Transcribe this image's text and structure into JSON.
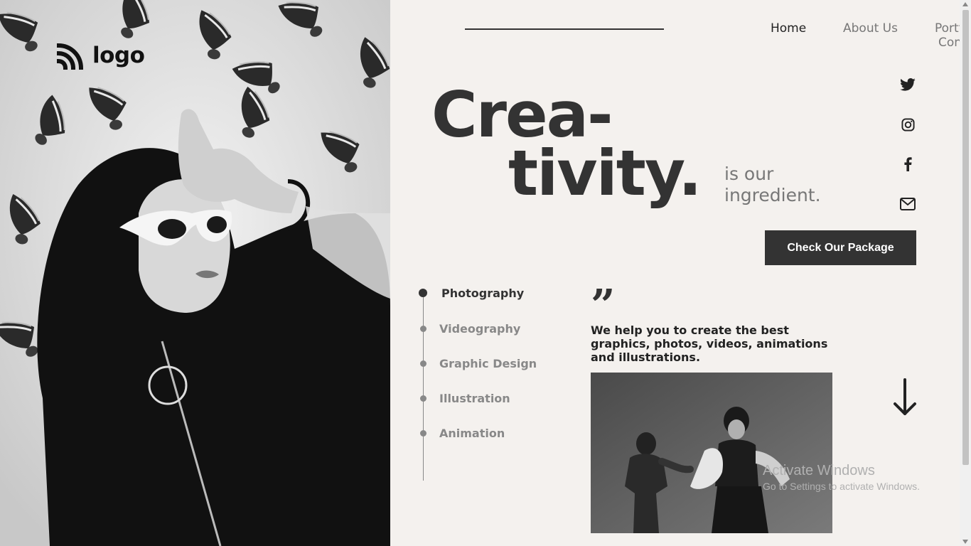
{
  "logo": {
    "text": "logo",
    "icon": "rss-waves-icon"
  },
  "nav": {
    "items": [
      {
        "label": "Home",
        "active": true
      },
      {
        "label": "About Us",
        "active": false
      },
      {
        "label": "Portfolio",
        "active": false
      },
      {
        "label": "Contact",
        "active": false
      }
    ]
  },
  "socials": [
    {
      "icon": "twitter-icon"
    },
    {
      "icon": "instagram-icon"
    },
    {
      "icon": "facebook-icon"
    },
    {
      "icon": "mail-icon"
    }
  ],
  "hero": {
    "line1": "Crea-",
    "line2": "tivity.",
    "tagline1": "is our",
    "tagline2": "ingredient."
  },
  "cta": {
    "label": "Check Our Package"
  },
  "services": [
    {
      "label": "Photography",
      "active": true
    },
    {
      "label": "Videography",
      "active": false
    },
    {
      "label": "Graphic Design",
      "active": false
    },
    {
      "label": "Illustration",
      "active": false
    },
    {
      "label": "Animation",
      "active": false
    }
  ],
  "quote": {
    "mark": "”",
    "text": "We help you to create the best graphics, photos, videos, animations and illustrations."
  },
  "arrow": {
    "icon": "arrow-down-icon"
  },
  "watermark": {
    "line1": "Activate Windows",
    "line2": "Go to Settings to activate Windows."
  },
  "colors": {
    "dark": "#333333",
    "muted": "#777777",
    "background": "#f4f1ee"
  }
}
